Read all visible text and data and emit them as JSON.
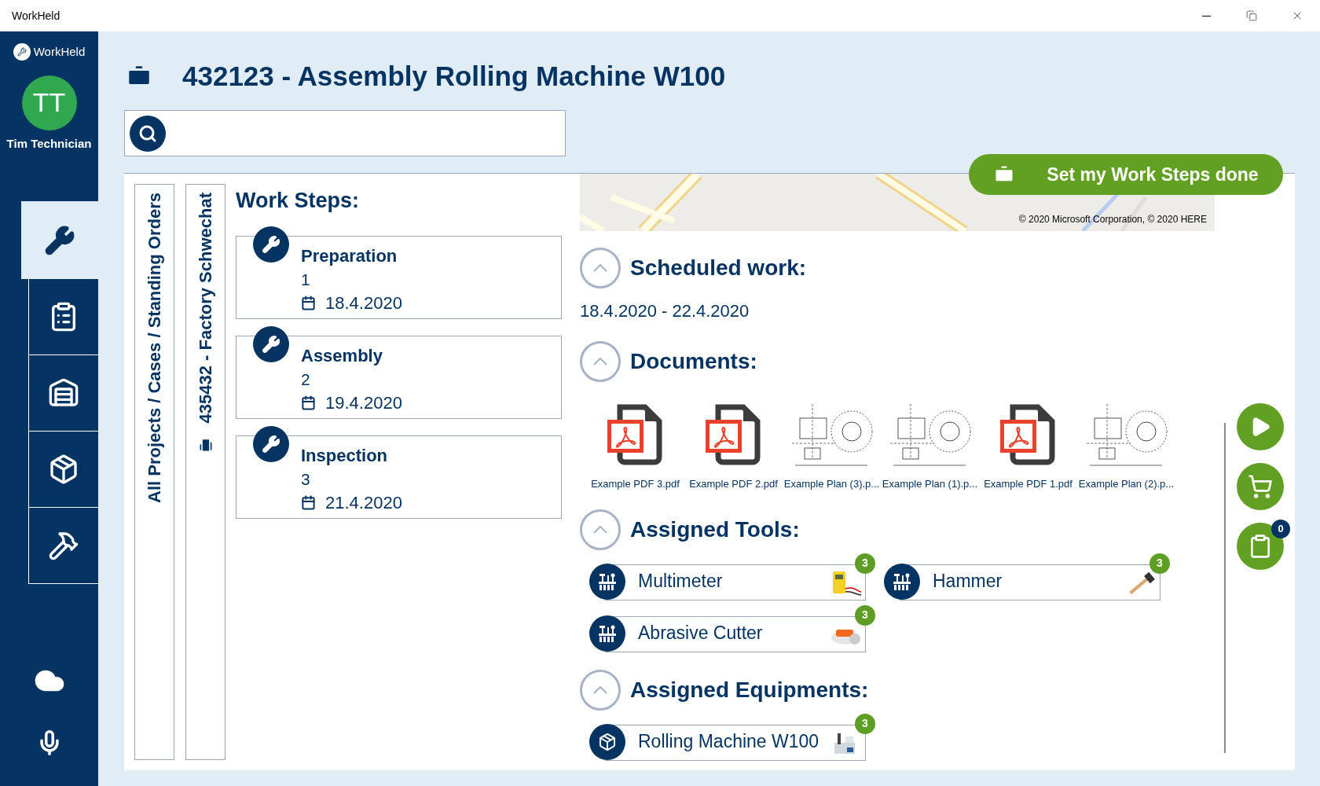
{
  "window": {
    "title": "WorkHeld"
  },
  "sidebar": {
    "logo": "WorkHeld",
    "avatar_initials": "TT",
    "user_name": "Tim Technician",
    "nav_items": [
      {
        "kind": "wrench",
        "selected": true
      },
      {
        "kind": "clipboard",
        "selected": false
      },
      {
        "kind": "warehouse",
        "selected": false
      },
      {
        "kind": "equipment",
        "selected": false
      },
      {
        "kind": "tools",
        "selected": false
      }
    ],
    "bottom_items": [
      {
        "kind": "sync"
      },
      {
        "kind": "mic"
      }
    ]
  },
  "header": {
    "title": "432123 - Assembly Rolling Machine W100"
  },
  "breadcrumbs": [
    {
      "label": "All Projects / Cases / Standing Orders",
      "kind": "text"
    },
    {
      "label": "435432 - Factory Schwechat",
      "kind": "site"
    }
  ],
  "work_steps": {
    "heading": "Work Steps:",
    "items": [
      {
        "name": "Preparation",
        "number": "1",
        "date": "18.4.2020"
      },
      {
        "name": "Assembly",
        "number": "2",
        "date": "19.4.2020"
      },
      {
        "name": "Inspection",
        "number": "3",
        "date": "21.4.2020"
      }
    ]
  },
  "map": {
    "attribution": "© 2020 Microsoft Corporation, © 2020 HERE"
  },
  "done_button": {
    "label": "Set my Work Steps done"
  },
  "sections": [
    {
      "kind": "schedule",
      "title": "Scheduled work:",
      "expanded": true,
      "text": "18.4.2020 - 22.4.2020"
    },
    {
      "kind": "documents",
      "title": "Documents:",
      "expanded": true,
      "items": [
        {
          "name": "Example PDF 3.pdf",
          "kind": "pdf"
        },
        {
          "name": "Example PDF 2.pdf",
          "kind": "pdf"
        },
        {
          "name": "Example Plan (3).p...",
          "kind": "plan"
        },
        {
          "name": "Example Plan (1).p...",
          "kind": "plan"
        },
        {
          "name": "Example PDF 1.pdf",
          "kind": "pdf"
        },
        {
          "name": "Example Plan (2).p...",
          "kind": "plan"
        }
      ]
    },
    {
      "kind": "tools",
      "title": "Assigned Tools:",
      "expanded": true,
      "items": [
        {
          "name": "Multimeter",
          "count": "3"
        },
        {
          "name": "Hammer",
          "count": "3"
        },
        {
          "name": "Abrasive Cutter",
          "count": "3"
        }
      ]
    },
    {
      "kind": "equipments",
      "title": "Assigned Equipments:",
      "expanded": true,
      "items": [
        {
          "name": "Rolling Machine W100",
          "count": "3"
        }
      ]
    }
  ],
  "actions": [
    {
      "kind": "play"
    },
    {
      "kind": "cart"
    },
    {
      "kind": "clipboard",
      "badge": "0"
    }
  ]
}
